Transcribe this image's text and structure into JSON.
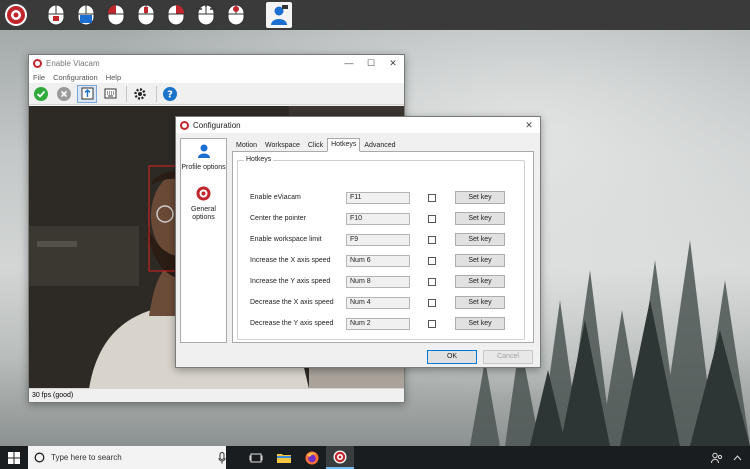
{
  "main_window": {
    "title": "Enable Viacam",
    "menu": [
      "File",
      "Configuration",
      "Help"
    ],
    "status": "30 fps (good)"
  },
  "config_dialog": {
    "title": "Configuration",
    "sidebar": [
      {
        "label": "Profile options"
      },
      {
        "label": "General options"
      }
    ],
    "tabs": [
      "Motion",
      "Workspace",
      "Click",
      "Hotkeys",
      "Advanced"
    ],
    "active_tab": "Hotkeys",
    "group_label": "Hotkeys",
    "rows": [
      {
        "label": "Enable eViacam",
        "key": "F11",
        "set": "Set key"
      },
      {
        "label": "Center the pointer",
        "key": "F10",
        "set": "Set key"
      },
      {
        "label": "Enable workspace limit",
        "key": "F9",
        "set": "Set key"
      },
      {
        "label": "Increase the X axis speed",
        "key": "Num 6",
        "set": "Set key"
      },
      {
        "label": "Increase the Y axis speed",
        "key": "Num 8",
        "set": "Set key"
      },
      {
        "label": "Decrease the X axis speed",
        "key": "Num 4",
        "set": "Set key"
      },
      {
        "label": "Decrease the Y axis speed",
        "key": "Num 2",
        "set": "Set key"
      }
    ],
    "ok": "OK",
    "cancel": "Cancel",
    "close_glyph": "✕"
  },
  "taskbar": {
    "search_placeholder": "Type here to search"
  },
  "colors": {
    "accent_red": "#c0262d",
    "check_green": "#2eaa3b",
    "help_blue": "#1a74c9",
    "taskbar": "#1a1d1f"
  }
}
